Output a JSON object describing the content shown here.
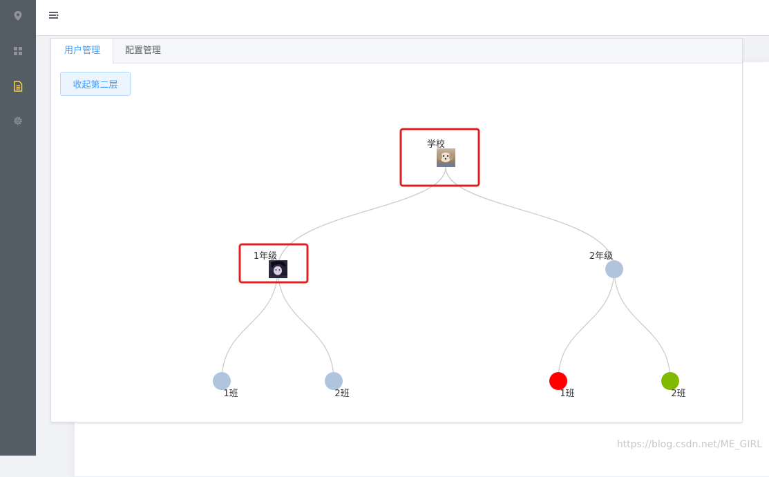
{
  "sidebar": {
    "items": [
      {
        "icon": "location-icon",
        "active": false
      },
      {
        "icon": "grid-icon",
        "active": false
      },
      {
        "icon": "document-icon",
        "active": true
      },
      {
        "icon": "gear-icon",
        "active": false
      }
    ],
    "colors": {
      "background": "#545c64",
      "icon": "#909399",
      "active_icon": "#ffd04b"
    }
  },
  "header": {
    "menu_icon": "hamburger-icon"
  },
  "tabs": [
    {
      "label": "用户管理",
      "active": true
    },
    {
      "label": "配置管理",
      "active": false
    }
  ],
  "toolbar": {
    "collapse_label": "收起第二层"
  },
  "tree": {
    "root": {
      "name": "学校",
      "avatar": "dog-avatar",
      "highlighted": true
    },
    "level1": [
      {
        "name": "1年级",
        "avatar": "anime-avatar",
        "highlighted": true
      },
      {
        "name": "2年级",
        "color": "#b0c4de",
        "highlighted": false
      }
    ],
    "level2": [
      {
        "name": "1班",
        "color": "#b0c4de"
      },
      {
        "name": "2班",
        "color": "#b0c4de"
      },
      {
        "name": "1班",
        "color": "#ff0000"
      },
      {
        "name": "2班",
        "color": "#7fba00"
      }
    ],
    "link_color": "#cccccc",
    "highlight_color": "#e02020"
  },
  "watermark": "https://blog.csdn.net/ME_GIRL"
}
